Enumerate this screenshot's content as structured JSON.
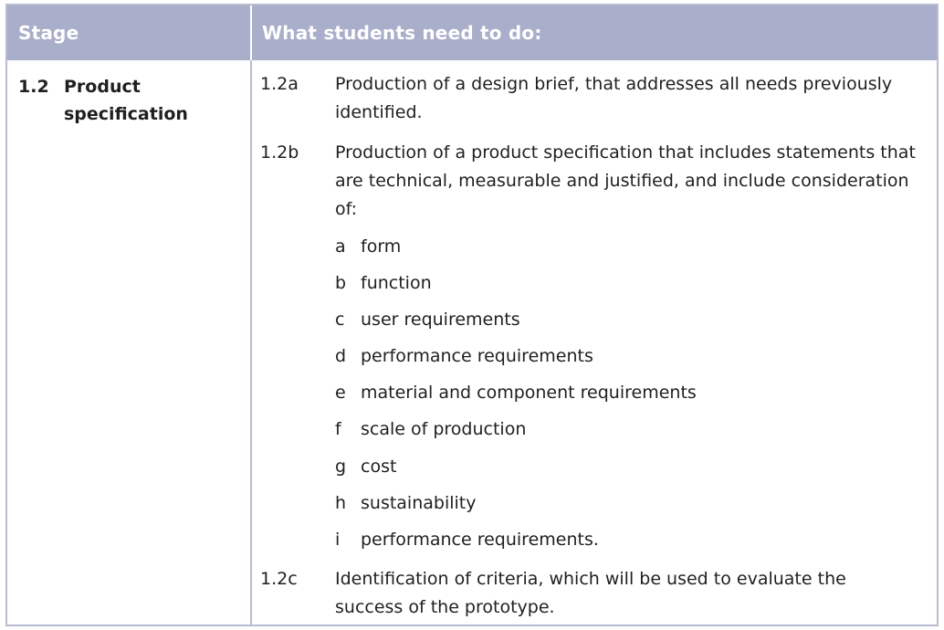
{
  "header": {
    "stage_label": "Stage",
    "tasks_label": "What students need to do:"
  },
  "stage": {
    "number": "1.2",
    "name": "Product specification"
  },
  "items": [
    {
      "code": "1.2a",
      "text": "Production of a design brief, that addresses all needs previously identified."
    },
    {
      "code": "1.2b",
      "text": "Production of a product specification that includes statements that are technical, measurable and justified, and include consideration of:",
      "sub_items": [
        {
          "letter": "a",
          "text": "form"
        },
        {
          "letter": "b",
          "text": "function"
        },
        {
          "letter": "c",
          "text": "user requirements"
        },
        {
          "letter": "d",
          "text": "performance requirements"
        },
        {
          "letter": "e",
          "text": "material and component requirements"
        },
        {
          "letter": "f",
          "text": "scale of production"
        },
        {
          "letter": "g",
          "text": "cost"
        },
        {
          "letter": "h",
          "text": "sustainability"
        },
        {
          "letter": "i",
          "text": "performance requirements."
        }
      ]
    },
    {
      "code": "1.2c",
      "text": "Identification of criteria, which will be used to evaluate the success of the prototype."
    }
  ],
  "colors": {
    "header_bg": "#a9aeca",
    "border": "#b9bccf",
    "header_text": "#ffffff",
    "body_text": "#1f1f1f"
  }
}
